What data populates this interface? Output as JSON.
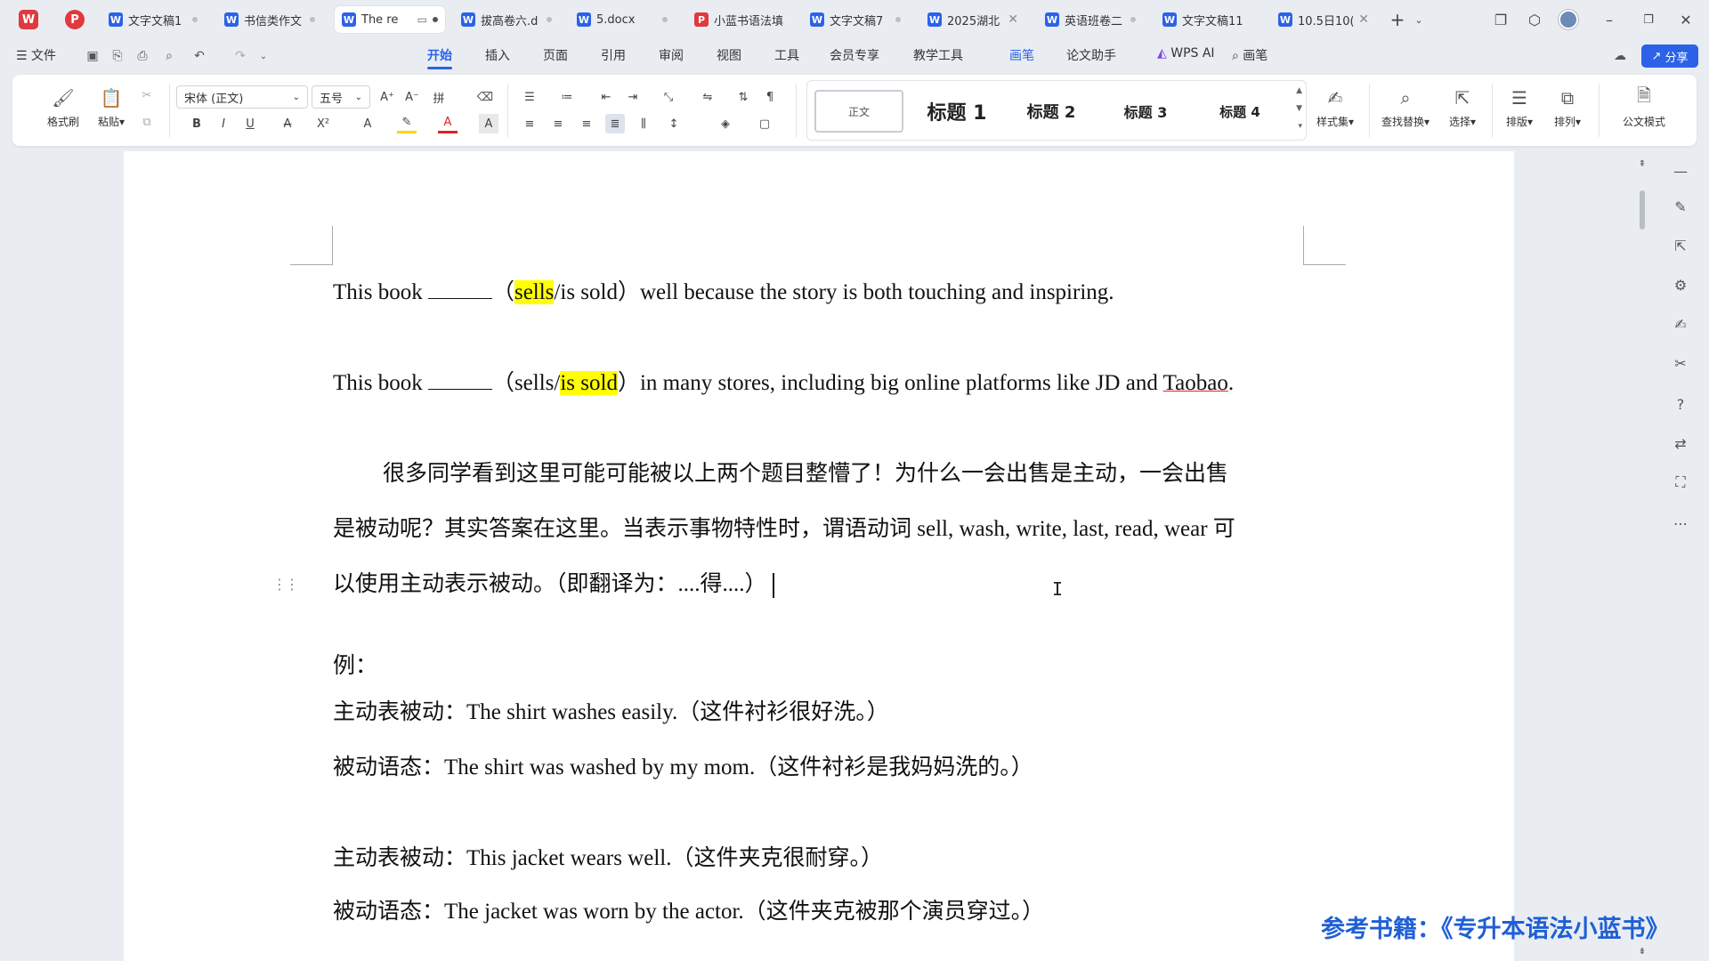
{
  "tabs": [
    {
      "label": "文字文稿1",
      "icon": "W"
    },
    {
      "label": "书信类作文",
      "icon": "W"
    },
    {
      "label": "The re",
      "icon": "W",
      "active": true
    },
    {
      "label": "拔高卷六.d",
      "icon": "W"
    },
    {
      "label": "5.docx",
      "icon": "W"
    },
    {
      "label": "小蓝书语法填",
      "icon": "P"
    },
    {
      "label": "文字文稿7",
      "icon": "W"
    },
    {
      "label": "2025湖北",
      "icon": "W"
    },
    {
      "label": "英语班卷二",
      "icon": "W"
    },
    {
      "label": "文字文稿11",
      "icon": "W"
    },
    {
      "label": "10.5日10(",
      "icon": "W"
    }
  ],
  "menubar": {
    "file": "文件",
    "items": [
      "开始",
      "插入",
      "页面",
      "引用",
      "审阅",
      "视图",
      "工具",
      "会员专享",
      "教学工具",
      "画笔",
      "论文助手"
    ],
    "wps_ai": "WPS AI",
    "search": "画笔",
    "share": "分享"
  },
  "ribbon": {
    "format_painter": "格式刷",
    "paste": "粘贴",
    "font_name": "宋体 (正文)",
    "font_size": "五号",
    "styles": {
      "normal": "正文",
      "h1": "标题 1",
      "h2": "标题 2",
      "h3": "标题 3",
      "h4": "标题 4"
    },
    "style_set": "样式集",
    "find_replace": "查找替换",
    "select": "选择",
    "layout": "排版",
    "arrange": "排列",
    "official_mode": "公文模式"
  },
  "document": {
    "line1": {
      "pre": "This book ",
      "paren_open": "（",
      "highlight": "sells",
      "post_hl": "/is sold）well because the story is both touching and inspiring."
    },
    "line2": {
      "pre": "This book ",
      "paren_open": "（sells/",
      "highlight": "is sold",
      "mid": "）in many stores, including big online platforms like JD and ",
      "underlined": "Taobao",
      "end": "."
    },
    "para1": "很多同学看到这里可能可能被以上两个题目整懵了！为什么一会出售是主动，一会出售",
    "para2": "是被动呢？其实答案在这里。当表示事物特性时，谓语动词 sell, wash, write, last, read, wear 可",
    "para3": "以使用主动表示被动。（即翻译为：....得....）",
    "example_label": "例：",
    "ex1": "主动表被动：The shirt washes easily.（这件衬衫很好洗。）",
    "ex2": "被动语态：The shirt was washed by my mom.（这件衬衫是我妈妈洗的。）",
    "ex3": "主动表被动：This jacket wears well.（这件夹克很耐穿。）",
    "ex4": "被动语态：The jacket was worn by the actor.（这件夹克被那个演员穿过。）"
  },
  "reference_caption": "参考书籍：《专升本语法小蓝书》",
  "colors": {
    "accent": "#2b62e8",
    "highlight": "#ffff00",
    "caption": "#1f5fd6"
  }
}
